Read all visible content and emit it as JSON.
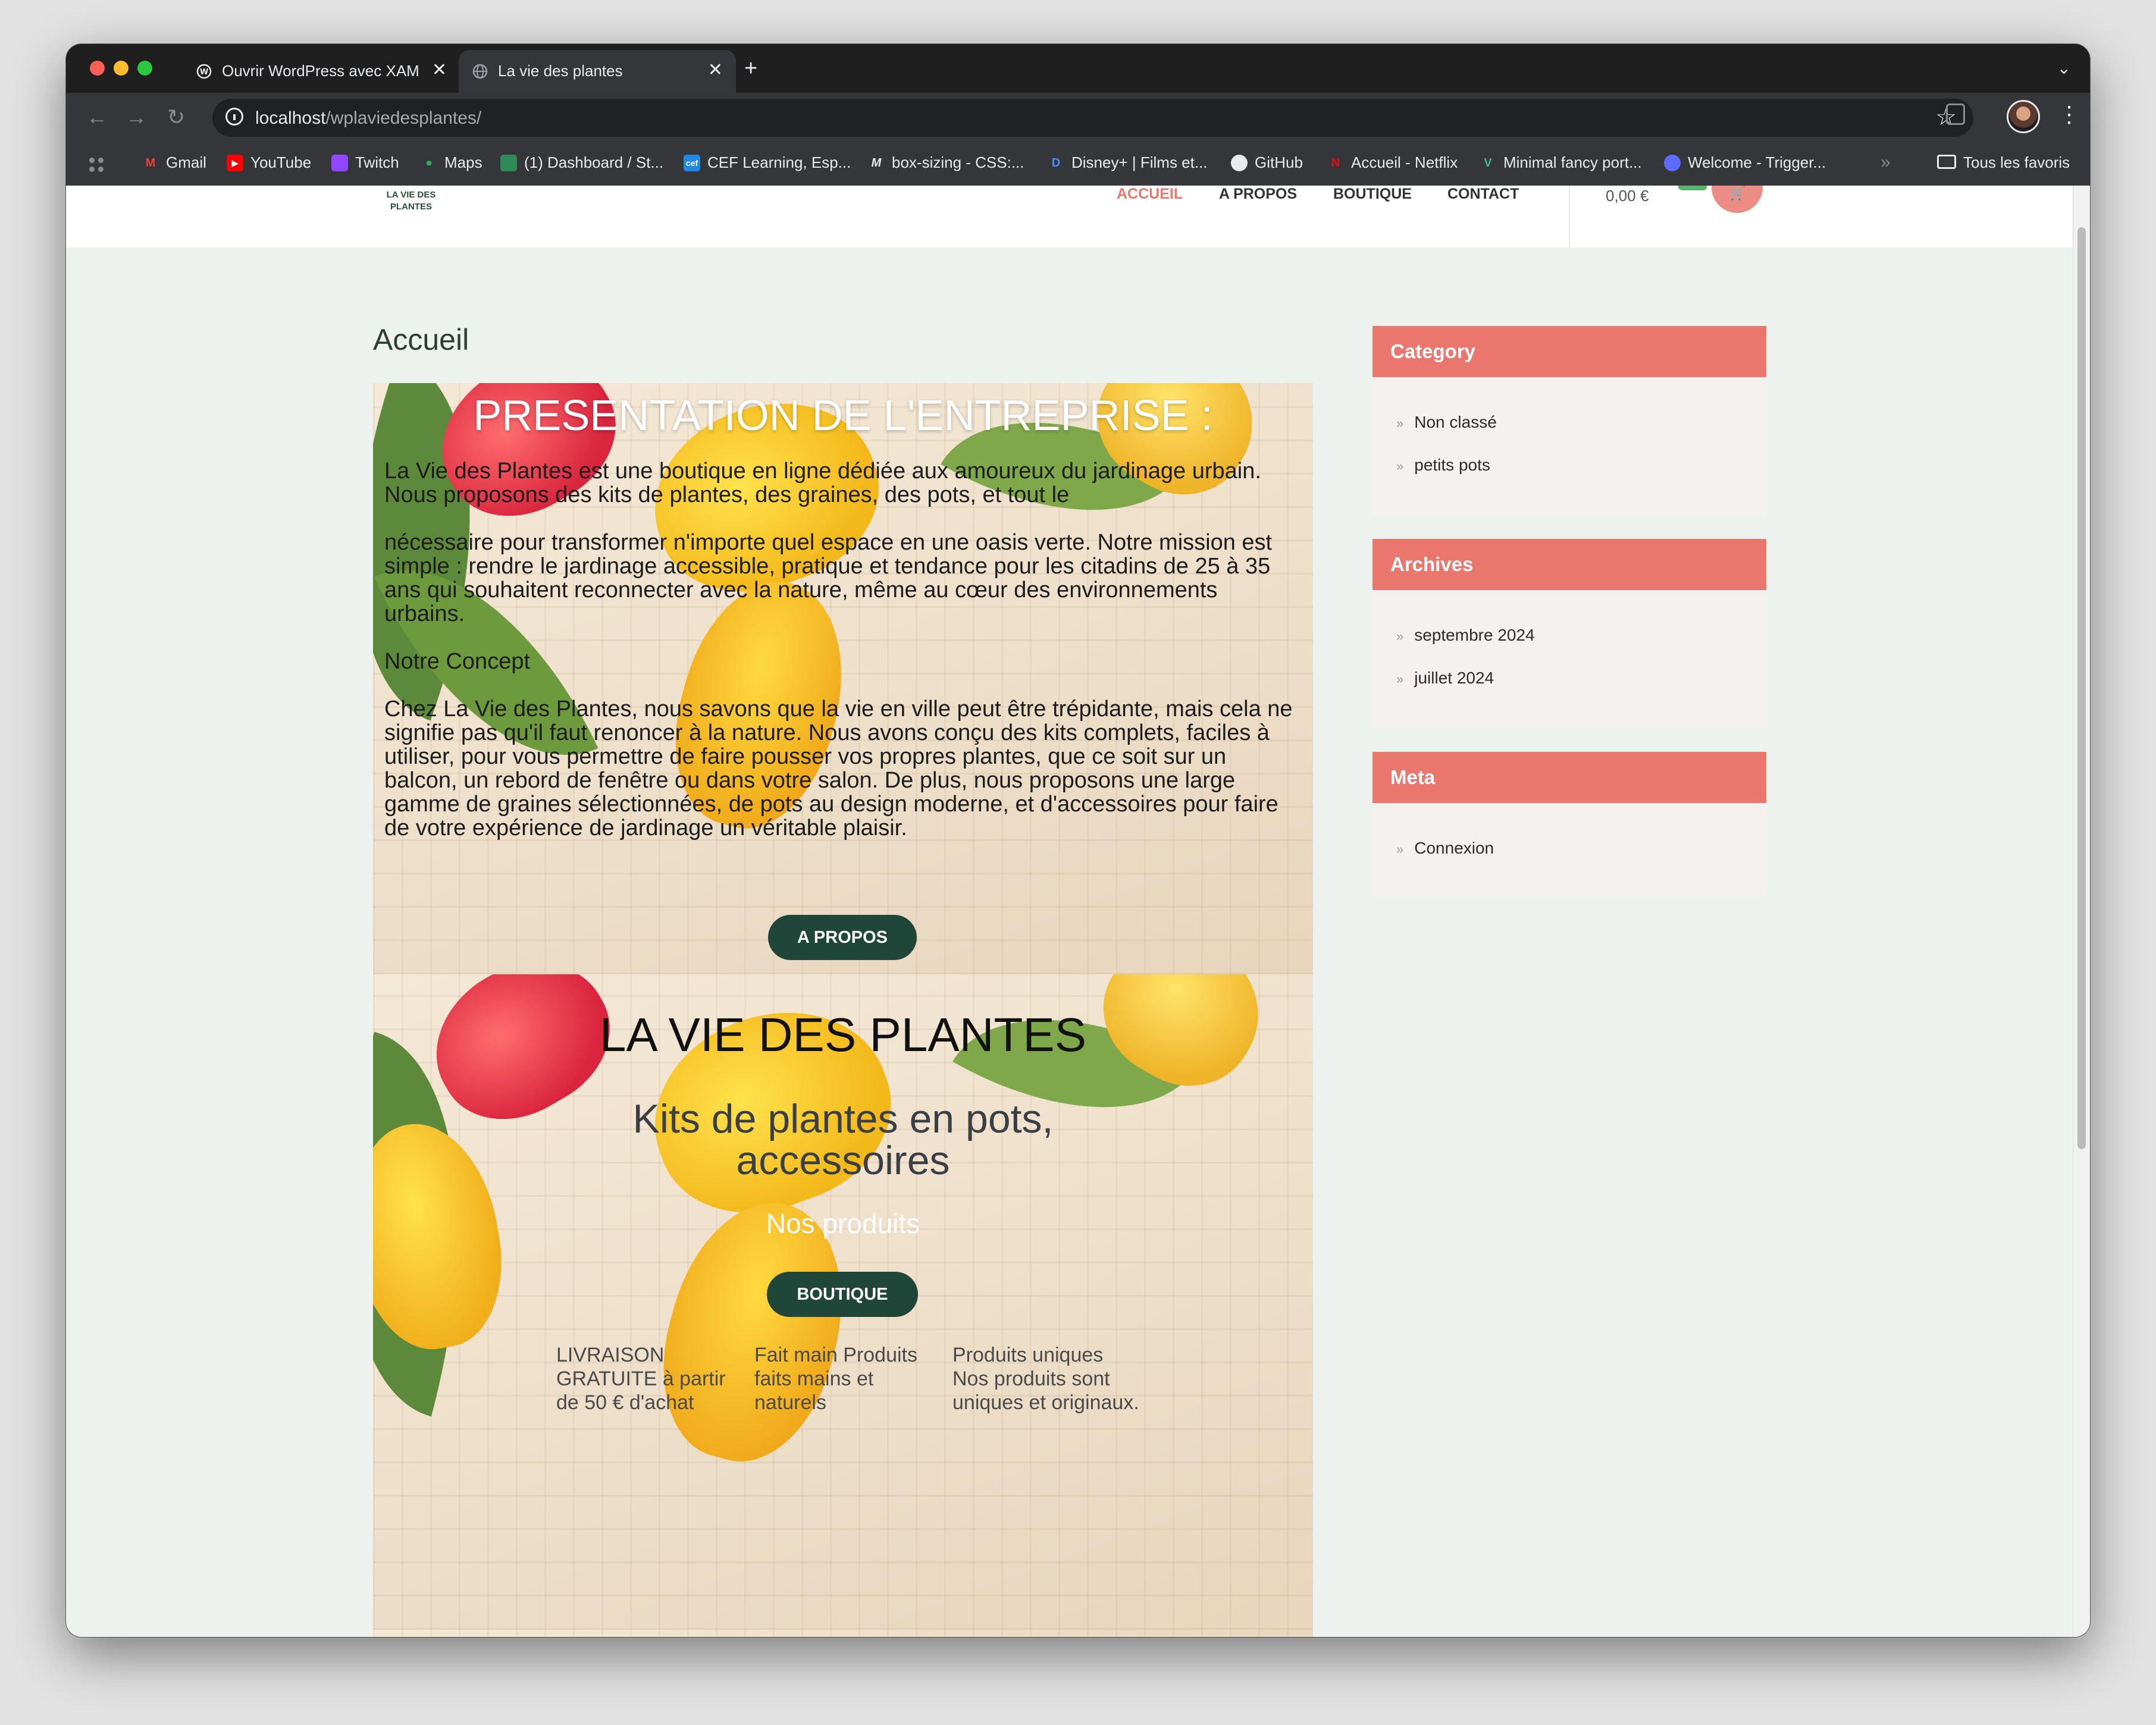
{
  "browser": {
    "tabs": [
      {
        "title": "Ouvrir WordPress avec XAMPP",
        "active": false
      },
      {
        "title": "La vie des plantes",
        "active": true
      }
    ],
    "url_host": "localhost",
    "url_path": "/wplaviedesplantes/",
    "bookmarks": [
      "Gmail",
      "YouTube",
      "Twitch",
      "Maps",
      "(1) Dashboard / St...",
      "CEF Learning, Esp...",
      "box-sizing - CSS:...",
      "Disney+ | Films et...",
      "GitHub",
      "Accueil - Netflix",
      "Minimal fancy port...",
      "Welcome - Trigger..."
    ],
    "all_bookmarks": "Tous les favoris"
  },
  "site": {
    "logo": "LA VIE DES PLANTES",
    "nav": [
      "ACCUEIL",
      "A PROPOS",
      "BOUTIQUE",
      "CONTACT"
    ],
    "active_nav": "ACCUEIL",
    "cart_total": "0,00 €",
    "page_title": "Accueil"
  },
  "section1": {
    "heading": "PRESENTATION DE L'ENTREPRISE :",
    "p1": "La Vie des Plantes est une boutique en ligne dédiée aux amoureux du jardinage urbain. Nous proposons des kits de plantes, des graines, des pots, et tout le",
    "p2": "nécessaire pour transformer n'importe quel espace en une oasis verte. Notre mission est simple : rendre le jardinage accessible, pratique et tendance pour les citadins de 25 à 35 ans qui souhaitent reconnecter avec la nature, même au cœur des environnements urbains.",
    "p3": "Notre Concept",
    "p4": "Chez La Vie des Plantes, nous savons que la vie en ville peut être trépidante, mais cela ne signifie pas qu'il faut renoncer à la nature. Nous avons conçu des kits complets, faciles à utiliser, pour vous permettre de faire pousser vos propres plantes, que ce soit sur un balcon, un rebord de fenêtre ou dans votre salon. De plus, nous proposons une large gamme de graines sélectionnées, de pots au design moderne, et d'accessoires pour faire de votre expérience de jardinage un véritable plaisir.",
    "button": "A PROPOS"
  },
  "section2": {
    "title": "LA VIE DES PLANTES",
    "subtitle": "Kits de plantes en pots, accessoires",
    "tagline": "Nos produits",
    "button": "BOUTIQUE",
    "features": [
      "LIVRAISON GRATUITE à partir de 50 € d'achat",
      "Fait main Produits faits mains et naturels",
      "Produits uniques Nos produits sont uniques et originaux."
    ]
  },
  "sidebar": {
    "category": {
      "title": "Category",
      "items": [
        "Non classé",
        "petits pots"
      ]
    },
    "archives": {
      "title": "Archives",
      "items": [
        "septembre 2024",
        "juillet 2024"
      ]
    },
    "meta": {
      "title": "Meta",
      "items": [
        "Connexion"
      ]
    }
  },
  "colors": {
    "accent": "#e9776e",
    "button": "#1f4638",
    "nav_active": "#e8776d",
    "page_bg": "#eef2ef"
  }
}
